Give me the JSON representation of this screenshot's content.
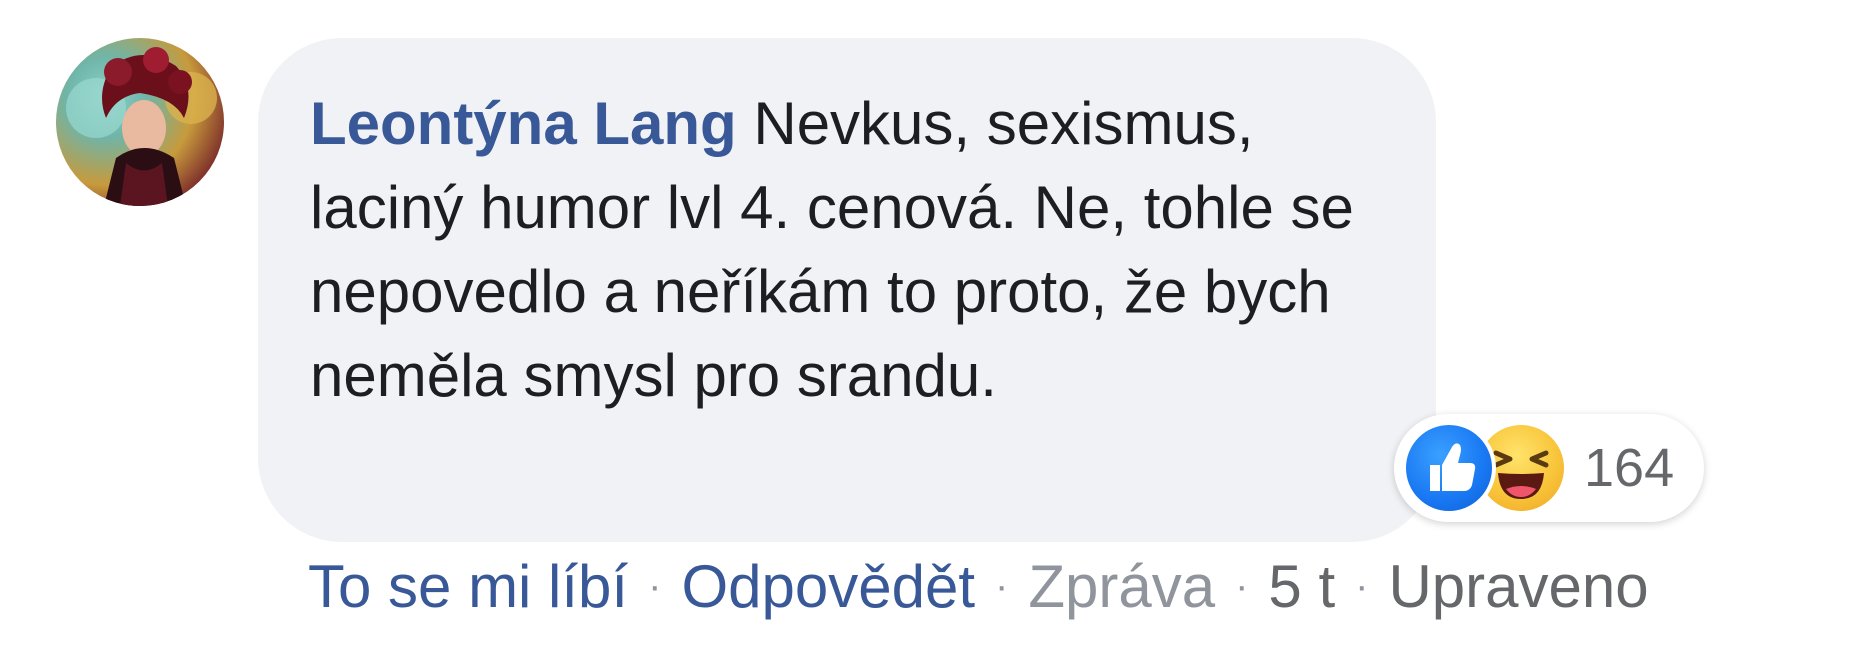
{
  "comment": {
    "author": "Leontýna Lang",
    "text": " Nevkus, sexismus, laciný humor lvl 4. cenová. Ne, tohle se nepovedlo a neříkám to proto, že bych neměla smysl pro srandu."
  },
  "reactions": {
    "icons": [
      "like-icon",
      "haha-icon"
    ],
    "count": "164"
  },
  "actions": {
    "like": "To se mi líbí",
    "reply": "Odpovědět",
    "message": "Zpráva",
    "time": "5 t",
    "edited": "Upraveno",
    "separator": "·"
  },
  "colors": {
    "author": "#385898",
    "bubble": "#f0f2f5",
    "like": "#1877f2",
    "haha": "#f8c53a"
  }
}
